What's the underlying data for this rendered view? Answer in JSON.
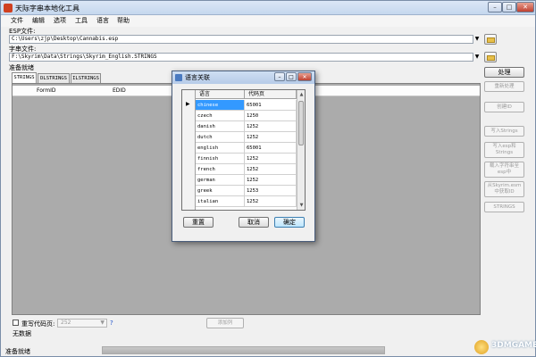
{
  "window": {
    "title": "天际字串本地化工具",
    "controls": {
      "minimize": "–",
      "maximize": "□",
      "close": "✕"
    }
  },
  "menu": {
    "items": [
      "文件",
      "编辑",
      "选项",
      "工具",
      "语言",
      "帮助"
    ]
  },
  "esp": {
    "label": "ESP文件:",
    "value": "C:\\Users\\zjp\\Desktop\\Cannabis.esp",
    "arrow": "▼"
  },
  "strings_file": {
    "label": "字串文件:",
    "value": "F:\\Skyrim\\Data\\Strings\\Skyrim_English.STRINGS",
    "arrow": "▼"
  },
  "status_top": "准备就绪",
  "tabs": [
    "STRINGS",
    "DLSTRINGS",
    "ILSTRINGS"
  ],
  "main_grid": {
    "columns": [
      "FormID",
      "EDID"
    ]
  },
  "side_buttons": [
    "处理",
    "重新处理",
    "创建ID",
    "写入Strings",
    "写入esp和Strings",
    "载入字符串至esp中",
    "从Skyrim.esm中获取ID",
    "STRINGS"
  ],
  "codepage": {
    "checkbox_label": "重写代码页:",
    "value": "252",
    "arrow": "▼",
    "help": "?"
  },
  "add_column_button": "添加列",
  "no_data": "无数据",
  "status_bottom": "准备就绪",
  "dialog": {
    "title": "语言关联",
    "controls": {
      "minimize": "–",
      "maximize": "□",
      "close": "✕"
    },
    "columns": [
      "语言",
      "代码页"
    ],
    "row_indicator": "▶",
    "rows": [
      {
        "lang": "chinese",
        "cp": "65001"
      },
      {
        "lang": "czech",
        "cp": "1250"
      },
      {
        "lang": "danish",
        "cp": "1252"
      },
      {
        "lang": "dutch",
        "cp": "1252"
      },
      {
        "lang": "english",
        "cp": "65001"
      },
      {
        "lang": "finnish",
        "cp": "1252"
      },
      {
        "lang": "french",
        "cp": "1252"
      },
      {
        "lang": "german",
        "cp": "1252"
      },
      {
        "lang": "greek",
        "cp": "1253"
      },
      {
        "lang": "italian",
        "cp": "1252"
      }
    ],
    "scroll_up": "▲",
    "scroll_down": "▼",
    "buttons": {
      "reset": "重置",
      "cancel": "取消",
      "ok": "确定"
    }
  },
  "watermark": "3DMGAME"
}
